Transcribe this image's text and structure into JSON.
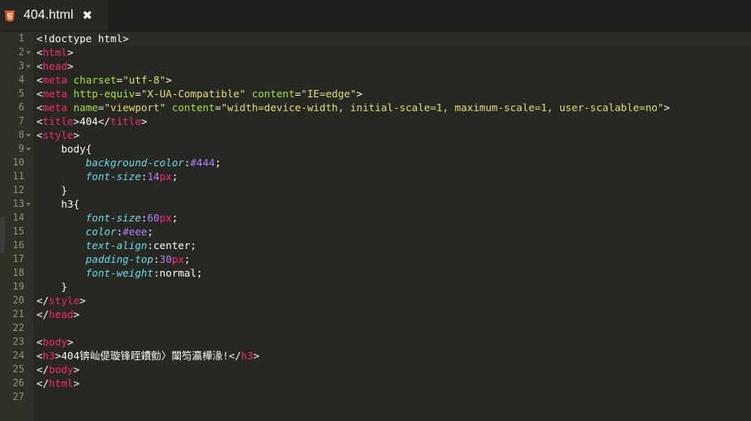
{
  "tab": {
    "filename": "404.html",
    "close_glyph": "✖",
    "file_icon": "html5-icon"
  },
  "line_numbers": [
    "1",
    "2",
    "3",
    "4",
    "5",
    "6",
    "7",
    "8",
    "9",
    "10",
    "11",
    "12",
    "13",
    "14",
    "15",
    "16",
    "17",
    "18",
    "19",
    "20",
    "21",
    "22",
    "23",
    "24",
    "25",
    "26",
    "27"
  ],
  "fold_lines": [
    2,
    3,
    8,
    9,
    13
  ],
  "code": {
    "l1": {
      "a": "<!doctype html>"
    },
    "l2": {
      "a": "<",
      "b": "html",
      "c": ">"
    },
    "l3": {
      "a": "<",
      "b": "head",
      "c": ">"
    },
    "l4": {
      "a": "<",
      "b": "meta",
      "c": " ",
      "d": "charset",
      "e": "=",
      "f": "\"utf-8\"",
      "g": ">"
    },
    "l5": {
      "a": "<",
      "b": "meta",
      "c": " ",
      "d": "http-equiv",
      "e": "=",
      "f": "\"X-UA-Compatible\"",
      "g": " ",
      "h": "content",
      "i": "=",
      "j": "\"IE=edge\"",
      "k": ">"
    },
    "l6": {
      "a": "<",
      "b": "meta",
      "c": " ",
      "d": "name",
      "e": "=",
      "f": "\"viewport\"",
      "g": " ",
      "h": "content",
      "i": "=",
      "j": "\"width=device-width, initial-scale=1, maximum-scale=1, user-scalable=no\"",
      "k": ">"
    },
    "l7": {
      "a": "<",
      "b": "title",
      "c": ">404</",
      "d": "title",
      "e": ">"
    },
    "l8": {
      "a": "<",
      "b": "style",
      "c": ">"
    },
    "l9": {
      "a": "    body{"
    },
    "l10": {
      "a": "        ",
      "b": "background-color",
      "c": ":",
      "d": "#444",
      "e": ";"
    },
    "l11": {
      "a": "        ",
      "b": "font-size",
      "c": ":",
      "d": "14",
      "e": "px",
      "f": ";"
    },
    "l12": {
      "a": "    }"
    },
    "l13": {
      "a": "    h3{"
    },
    "l14": {
      "a": "        ",
      "b": "font-size",
      "c": ":",
      "d": "60",
      "e": "px",
      "f": ";"
    },
    "l15": {
      "a": "        ",
      "b": "color",
      "c": ":",
      "d": "#eee",
      "e": ";"
    },
    "l16": {
      "a": "        ",
      "b": "text-align",
      "c": ":center;"
    },
    "l17": {
      "a": "        ",
      "b": "padding-top",
      "c": ":",
      "d": "30",
      "e": "px",
      "f": ";"
    },
    "l18": {
      "a": "        ",
      "b": "font-weight",
      "c": ":normal;"
    },
    "l19": {
      "a": "    }"
    },
    "l20": {
      "a": "</",
      "b": "style",
      "c": ">"
    },
    "l21": {
      "a": "</",
      "b": "head",
      "c": ">"
    },
    "l22": {
      "a": ""
    },
    "l23": {
      "a": "<",
      "b": "body",
      "c": ">"
    },
    "l24": {
      "a": "<",
      "b": "h3",
      "c": ">404锛屾偍璇锋眰鐨勯〉闈笉瀛樺湪!</",
      "d": "h3",
      "e": ">"
    },
    "l25": {
      "a": "</",
      "b": "body",
      "c": ">"
    },
    "l26": {
      "a": "</",
      "b": "html",
      "c": ">"
    },
    "l27": {
      "a": ""
    }
  },
  "colors": {
    "editor_bg": "#272822",
    "gutter_bg": "#2f3129",
    "tag": "#f92672",
    "attribute": "#a6e22e",
    "string": "#e6db74",
    "property": "#66d9ef",
    "number": "#ae81ff",
    "html5_badge": "#e44d26"
  }
}
